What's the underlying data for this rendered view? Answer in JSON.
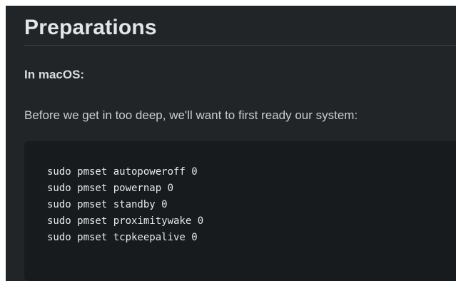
{
  "article": {
    "heading": "Preparations",
    "subheading": "In macOS:",
    "paragraph": "Before we get in too deep, we'll want to first ready our system:",
    "code_lines": [
      "sudo pmset autopoweroff 0",
      "sudo pmset powernap 0",
      "sudo pmset standby 0",
      "sudo pmset proximitywake 0",
      "sudo pmset tcpkeepalive 0"
    ]
  },
  "colors": {
    "background": "#222528",
    "code_background": "#181b1d",
    "heading_text": "#e3e5e7",
    "body_text": "#c9ccd0",
    "code_text": "#e6e8ea"
  }
}
